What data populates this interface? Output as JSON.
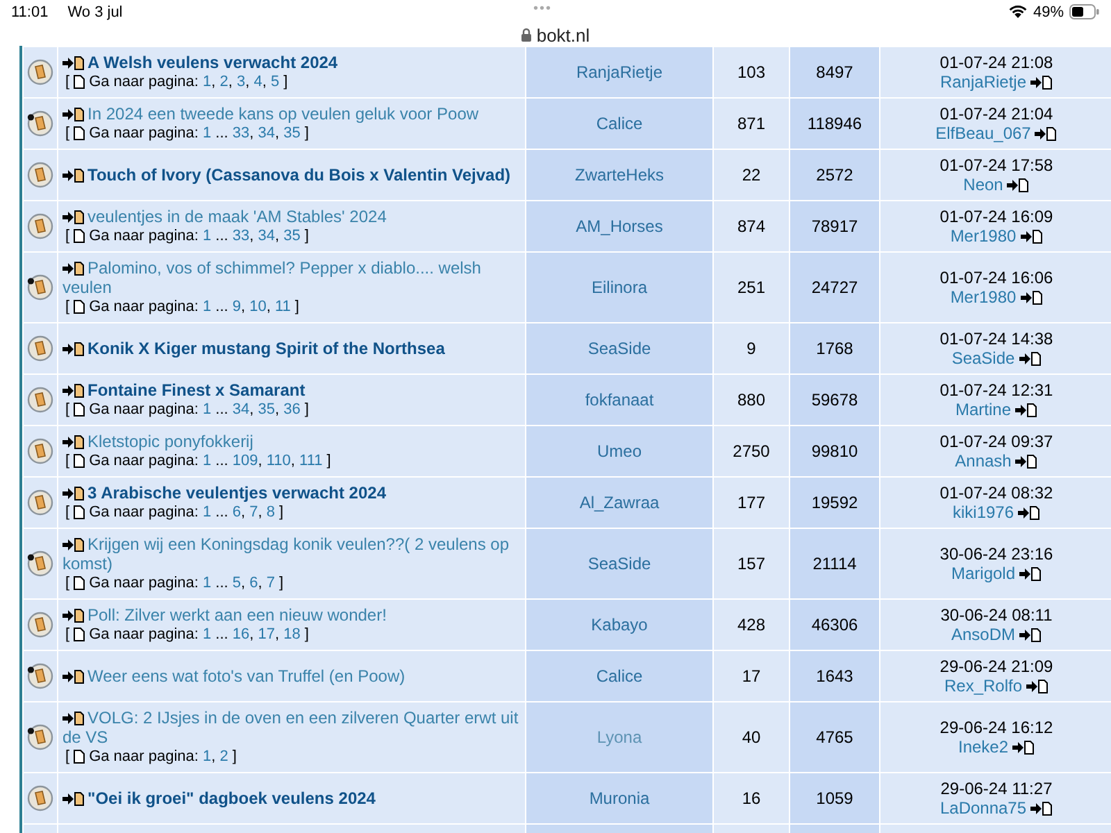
{
  "status_bar": {
    "time": "11:01",
    "date": "Wo 3 jul",
    "dots": "•••",
    "battery_text": "49%"
  },
  "address_bar": {
    "url": "bokt.nl"
  },
  "topics": [
    {
      "title": "A Welsh veulens verwacht 2024",
      "unread": true,
      "posted": false,
      "pagination": {
        "open": "[",
        "label": "Ga naar pagina:",
        "parts": [
          "1",
          ", ",
          "2",
          ", ",
          "3",
          ", ",
          "4",
          ", ",
          "5"
        ],
        "close": "]"
      },
      "author": {
        "name": "RanjaRietje",
        "color": "#2b6f9e"
      },
      "replies": "103",
      "views": "8497",
      "last_date": "01-07-24 21:08",
      "last_author": "RanjaRietje"
    },
    {
      "title": "In 2024 een tweede kans op veulen geluk voor Poow",
      "unread": false,
      "posted": true,
      "pagination": {
        "open": "[",
        "label": "Ga naar pagina:",
        "parts": [
          "1",
          " ... ",
          "33",
          ", ",
          "34",
          ", ",
          "35"
        ],
        "close": "]"
      },
      "author": {
        "name": "Calice",
        "color": "#2b6f9e"
      },
      "replies": "871",
      "views": "118946",
      "last_date": "01-07-24 21:04",
      "last_author": "ElfBeau_067"
    },
    {
      "title": "Touch of Ivory (Cassanova du Bois x Valentin Vejvad)",
      "unread": true,
      "posted": false,
      "author": {
        "name": "ZwarteHeks",
        "color": "#2b6f9e"
      },
      "replies": "22",
      "views": "2572",
      "last_date": "01-07-24 17:58",
      "last_author": "Neon"
    },
    {
      "title": "veulentjes in de maak 'AM Stables' 2024",
      "unread": false,
      "posted": false,
      "pagination": {
        "open": "[",
        "label": "Ga naar pagina:",
        "parts": [
          "1",
          " ... ",
          "33",
          ", ",
          "34",
          ", ",
          "35"
        ],
        "close": "]"
      },
      "author": {
        "name": "AM_Horses",
        "color": "#2b6f9e"
      },
      "replies": "874",
      "views": "78917",
      "last_date": "01-07-24 16:09",
      "last_author": "Mer1980"
    },
    {
      "title": "Palomino, vos of schimmel? Pepper x diablo.... welsh veulen",
      "unread": false,
      "posted": true,
      "pagination": {
        "open": "[",
        "label": "Ga naar pagina:",
        "parts": [
          "1",
          " ... ",
          "9",
          ", ",
          "10",
          ", ",
          "11"
        ],
        "close": "]"
      },
      "author": {
        "name": "Eilinora",
        "color": "#2b6f9e"
      },
      "replies": "251",
      "views": "24727",
      "last_date": "01-07-24 16:06",
      "last_author": "Mer1980"
    },
    {
      "title": "Konik X Kiger mustang Spirit of the Northsea",
      "unread": true,
      "posted": false,
      "author": {
        "name": "SeaSide",
        "color": "#2b6f9e"
      },
      "replies": "9",
      "views": "1768",
      "last_date": "01-07-24 14:38",
      "last_author": "SeaSide"
    },
    {
      "title": "Fontaine Finest x Samarant",
      "unread": true,
      "posted": false,
      "pagination": {
        "open": "[",
        "label": "Ga naar pagina:",
        "parts": [
          "1",
          " ... ",
          "34",
          ", ",
          "35",
          ", ",
          "36"
        ],
        "close": "]"
      },
      "author": {
        "name": "fokfanaat",
        "color": "#2b6f9e"
      },
      "replies": "880",
      "views": "59678",
      "last_date": "01-07-24 12:31",
      "last_author": "Martine"
    },
    {
      "title": "Kletstopic ponyfokkerij",
      "unread": false,
      "posted": false,
      "pagination": {
        "open": "[",
        "label": "Ga naar pagina:",
        "parts": [
          "1",
          " ... ",
          "109",
          ", ",
          "110",
          ", ",
          "111"
        ],
        "close": "]"
      },
      "author": {
        "name": "Umeo",
        "color": "#2b6f9e"
      },
      "replies": "2750",
      "views": "99810",
      "last_date": "01-07-24 09:37",
      "last_author": "Annash"
    },
    {
      "title": "3 Arabische veulentjes verwacht 2024",
      "unread": true,
      "posted": false,
      "pagination": {
        "open": "[",
        "label": "Ga naar pagina:",
        "parts": [
          "1",
          " ... ",
          "6",
          ", ",
          "7",
          ", ",
          "8"
        ],
        "close": "]"
      },
      "author": {
        "name": "Al_Zawraa",
        "color": "#2b6f9e"
      },
      "replies": "177",
      "views": "19592",
      "last_date": "01-07-24 08:32",
      "last_author": "kiki1976"
    },
    {
      "title": "Krijgen wij een Koningsdag konik veulen??( 2 veulens op komst)",
      "unread": false,
      "posted": true,
      "pagination": {
        "open": "[",
        "label": "Ga naar pagina:",
        "parts": [
          "1",
          " ... ",
          "5",
          ", ",
          "6",
          ", ",
          "7"
        ],
        "close": "]"
      },
      "author": {
        "name": "SeaSide",
        "color": "#2b6f9e"
      },
      "replies": "157",
      "views": "21114",
      "last_date": "30-06-24 23:16",
      "last_author": "Marigold"
    },
    {
      "title": "Poll: Zilver werkt aan een nieuw wonder!",
      "unread": false,
      "posted": false,
      "pagination": {
        "open": "[",
        "label": "Ga naar pagina:",
        "parts": [
          "1",
          " ... ",
          "16",
          ", ",
          "17",
          ", ",
          "18"
        ],
        "close": "]"
      },
      "author": {
        "name": "Kabayo",
        "color": "#2b6f9e"
      },
      "replies": "428",
      "views": "46306",
      "last_date": "30-06-24 08:11",
      "last_author": "AnsoDM"
    },
    {
      "title": "Weer eens wat foto's van Truffel (en Poow)",
      "unread": false,
      "posted": true,
      "author": {
        "name": "Calice",
        "color": "#2b6f9e"
      },
      "replies": "17",
      "views": "1643",
      "last_date": "29-06-24 21:09",
      "last_author": "Rex_Rolfo"
    },
    {
      "title": "VOLG: 2 IJsjes in de oven en een zilveren Quarter erwt uit de VS",
      "unread": false,
      "posted": true,
      "pagination": {
        "open": "[",
        "label": "Ga naar pagina:",
        "parts": [
          "1",
          ", ",
          "2"
        ],
        "close": "]"
      },
      "author": {
        "name": "Lyona",
        "color": "#5e93b3"
      },
      "replies": "40",
      "views": "4765",
      "last_date": "29-06-24 16:12",
      "last_author": "Ineke2"
    },
    {
      "title": "\"Oei ik groei\" dagboek veulens 2024",
      "unread": true,
      "posted": false,
      "author": {
        "name": "Muronia",
        "color": "#2b6f9e"
      },
      "replies": "16",
      "views": "1059",
      "last_date": "29-06-24 11:27",
      "last_author": "LaDonna75"
    }
  ]
}
